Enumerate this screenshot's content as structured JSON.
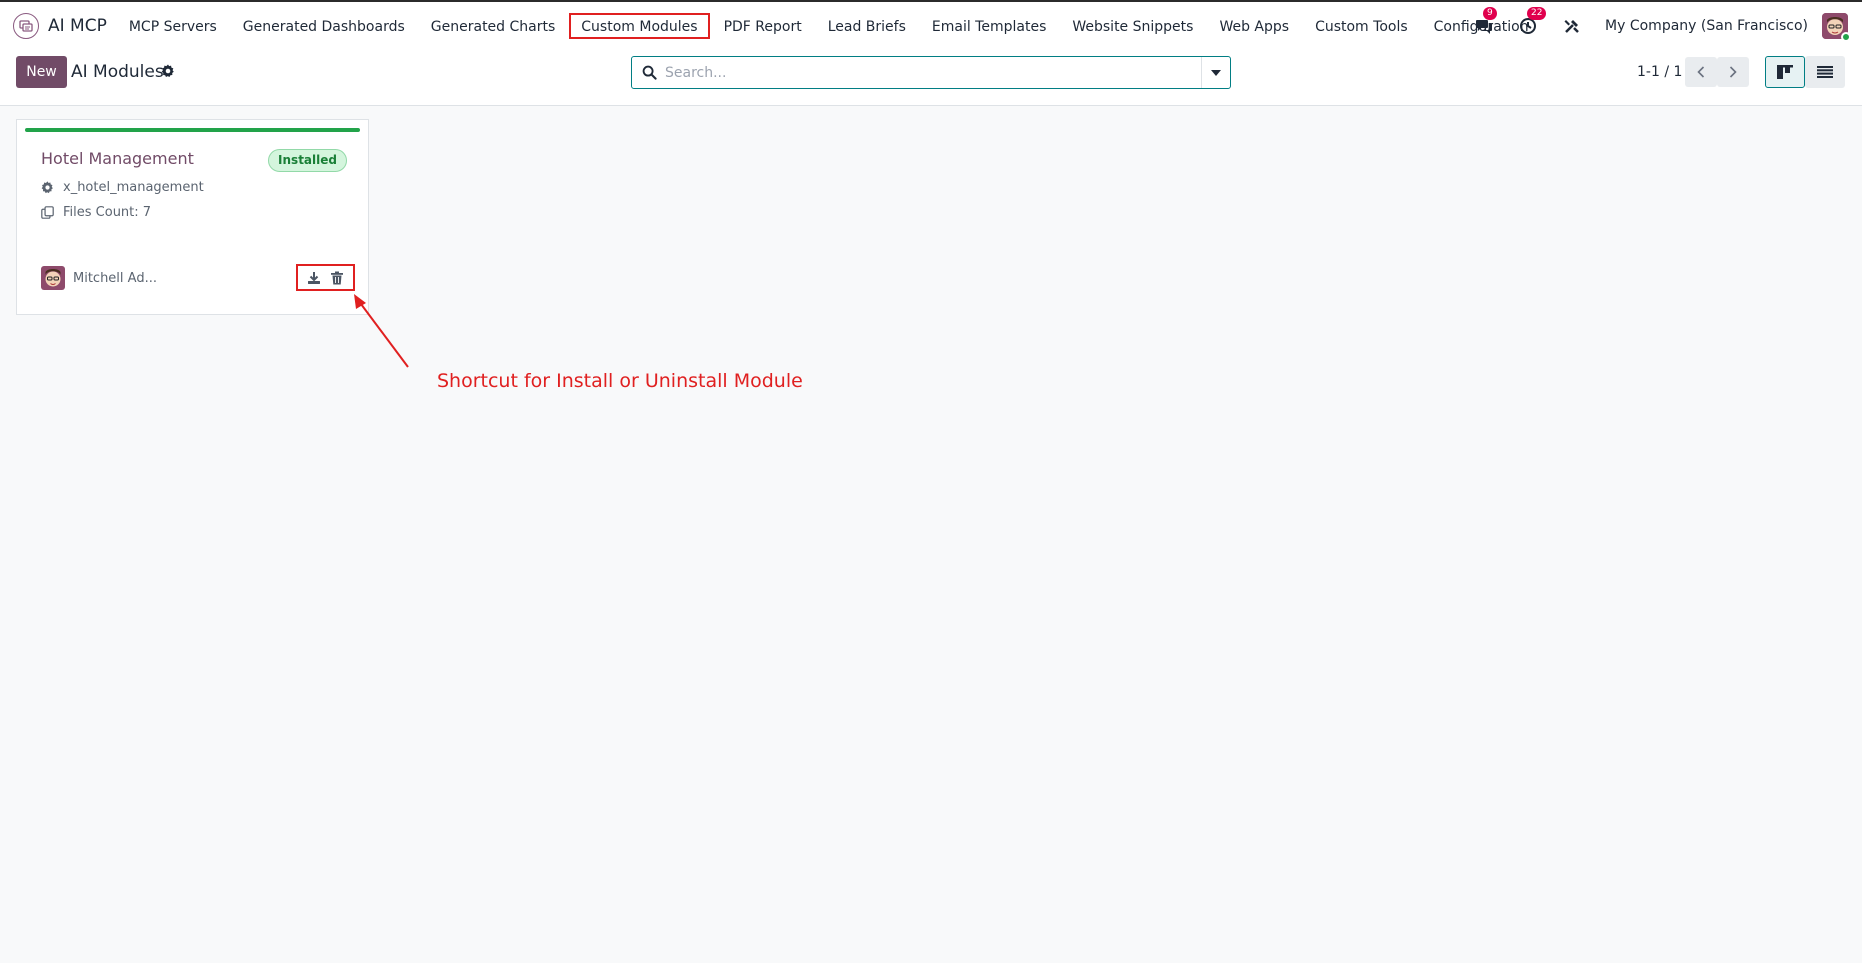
{
  "app": {
    "name": "AI MCP"
  },
  "menu": {
    "items": [
      {
        "label": "MCP Servers"
      },
      {
        "label": "Generated Dashboards"
      },
      {
        "label": "Generated Charts"
      },
      {
        "label": "Custom Modules"
      },
      {
        "label": "PDF Report"
      },
      {
        "label": "Lead Briefs"
      },
      {
        "label": "Email Templates"
      },
      {
        "label": "Website Snippets"
      },
      {
        "label": "Web Apps"
      },
      {
        "label": "Custom Tools"
      },
      {
        "label": "Configuration"
      }
    ]
  },
  "systray": {
    "messages_count": "9",
    "activities_count": "22",
    "company": "My Company (San Francisco)"
  },
  "control": {
    "new_label": "New",
    "title": "AI Modules",
    "search_placeholder": "Search...",
    "pager": "1-1 / 1"
  },
  "card": {
    "title": "Hotel Management",
    "status": "Installed",
    "technical_name": "x_hotel_management",
    "files_count": "Files Count: 7",
    "owner": "Mitchell Ad...",
    "accent_color": "#22a34a"
  },
  "annotation": {
    "text": "Shortcut for Install or Uninstall Module",
    "color": "#e02020"
  },
  "icons": {
    "brand": "ai-mcp-app-icon",
    "messages": "chat-icon",
    "activities": "clock-icon",
    "debug": "tools-icon",
    "download": "download-icon",
    "delete": "trash-icon"
  },
  "colors": {
    "brand": "#714b67",
    "accent": "#017e84"
  }
}
